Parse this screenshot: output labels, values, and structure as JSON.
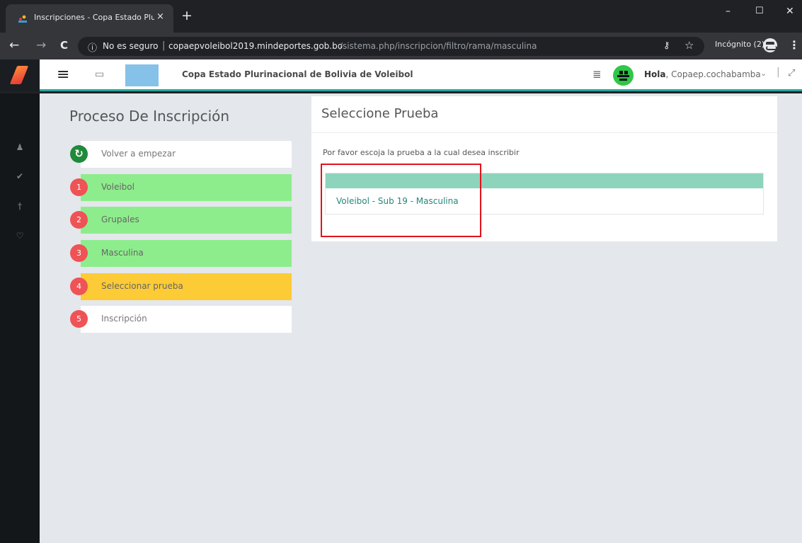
{
  "browser": {
    "tab_title": "Inscripciones - Copa Estado Pluri",
    "tab_close": "×",
    "new_tab": "+",
    "window_minimize": "–",
    "window_maximize": "☐",
    "window_close": "✕",
    "back_icon": "←",
    "forward_icon": "→",
    "reload_icon": "C",
    "url_security_icon": "ⓘ",
    "url_security_text": "No es seguro",
    "url_separator": "|",
    "url_host": "copaepvoleibol2019.mindeportes.gob.bo",
    "url_path": "/sistema.php/inscripcion/filtro/rama/masculina",
    "key_icon": "⚷",
    "star_icon": "☆",
    "incognito_text": "Incógnito (2)",
    "menu_icon": "⋮"
  },
  "header": {
    "menu_icon": "≡",
    "laptop_icon": "▭",
    "title": "Copa Estado Plurinacional de Bolivia de Voleibol",
    "messages_icon": "≣",
    "greeting_prefix": "Hola",
    "greeting_user": ", Copaep.cochabamba",
    "chevron": "⌄",
    "divider": "|",
    "expand_icon": "⤢"
  },
  "sidebar": {
    "icons": [
      "user-icon",
      "check-icon",
      "trophy-icon",
      "shield-icon"
    ],
    "glyphs": [
      "♟",
      "✔",
      "†",
      "♡"
    ]
  },
  "steps": {
    "title": "Proceso De Inscripción",
    "restart_icon": "↻",
    "items": [
      {
        "num": "",
        "label": "Volver a empezar",
        "status": "restart"
      },
      {
        "num": "1",
        "label": "Voleibol",
        "status": "done"
      },
      {
        "num": "2",
        "label": "Grupales",
        "status": "done"
      },
      {
        "num": "3",
        "label": "Masculina",
        "status": "done"
      },
      {
        "num": "4",
        "label": "Seleccionar prueba",
        "status": "current"
      },
      {
        "num": "5",
        "label": "Inscripción",
        "status": "pending"
      }
    ]
  },
  "panel": {
    "title": "Seleccione Prueba",
    "hint": "Por favor escoja la prueba a la cual desea inscribir",
    "option": "Voleibol - Sub 19 - Masculina"
  },
  "colors": {
    "done": "#8ded8c",
    "current": "#fccb36",
    "pending": "#ffffff",
    "accent": "#26a69a",
    "highlight": "#e0141e"
  }
}
